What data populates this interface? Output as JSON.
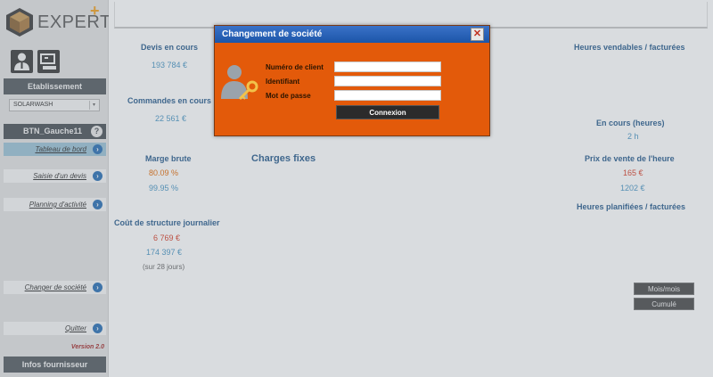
{
  "brand": {
    "name": "EXPERT",
    "plus": "+"
  },
  "sidebar": {
    "etablissement_header": "Etablissement",
    "company_select": {
      "value": "SOLARWASH"
    },
    "btn_left_label": "BTN_Gauche11",
    "help_glyph": "?",
    "nav": [
      {
        "label": "Tableau de bord",
        "active": true
      },
      {
        "label": "Saisie d'un devis",
        "active": false
      },
      {
        "label": "Planning d'activité",
        "active": false
      },
      {
        "label": "Changer de société",
        "active": false
      },
      {
        "label": "Quitter",
        "active": false
      }
    ],
    "version": "Version 2.0",
    "suppliers_header": "Infos fournisseur"
  },
  "dashboard": {
    "devis_label": "Devis en cours",
    "devis_value": "193 784 €",
    "commandes_label": "Commandes en cours",
    "commandes_value": "22 561 €",
    "marge_label": "Marge brute",
    "marge_value1": "80.09 %",
    "marge_value2": "99.95 %",
    "charges_fixes_label": "Charges fixes",
    "cout_label": "Coût de structure journalier",
    "cout_value1": "6 769 €",
    "cout_value2": "174 397 €",
    "cout_note": "(sur 28 jours)",
    "heures_vendables_label": "Heures vendables / facturées",
    "en_cours_heures_label": "En cours (heures)",
    "en_cours_heures_value": "2 h",
    "prix_heure_label": "Prix de vente de l'heure",
    "prix_heure_value1": "165 €",
    "prix_heure_value2": "1202 €",
    "heures_planifiees_label": "Heures planifiées / facturées",
    "mois_button": "Mois/mois",
    "cumule_button": "Cumulé"
  },
  "modal": {
    "title": "Changement de société",
    "close_glyph": "✕",
    "fields": {
      "client_label": "Numéro de client",
      "client_value": "",
      "id_label": "Identifiant",
      "id_value": "",
      "password_label": "Mot de passe",
      "password_value": ""
    },
    "submit_label": "Connexion"
  },
  "colors": {
    "accent_blue": "#2a5d8e",
    "modal_orange": "#e35a0a",
    "modal_title_blue": "#1c55a8",
    "value_orange": "#e46c0a"
  },
  "icons": [
    "expert-cube-icon",
    "user-profile-icon",
    "computer-icon",
    "chevron-right-icon",
    "help-icon",
    "user-key-icon",
    "close-icon",
    "select-arrow-icon"
  ]
}
